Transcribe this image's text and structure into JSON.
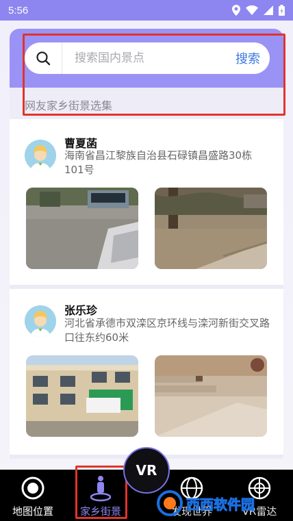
{
  "status_bar": {
    "time": "5:56"
  },
  "search": {
    "placeholder": "搜索国内景点",
    "button_label": "搜索"
  },
  "section": {
    "title": "网友家乡街景选集"
  },
  "posts": [
    {
      "name": "曹夏菡",
      "address": "海南省昌江黎族自治县石碌镇昌盛路30栋101号"
    },
    {
      "name": "张乐珍",
      "address": "河北省承德市双滦区京环线与滦河新街交叉路口往东约60米"
    }
  ],
  "bottom_nav": {
    "items": [
      {
        "label": "地图位置",
        "icon": "target-icon"
      },
      {
        "label": "家乡街景",
        "icon": "person-pin-icon"
      },
      {
        "label": "发现世界",
        "icon": "globe-icon"
      },
      {
        "label": "VR雷达",
        "icon": "radar-icon"
      }
    ],
    "vr_label": "VR"
  },
  "watermark": {
    "text": "西西软件园"
  },
  "colors": {
    "accent": "#9a92f5",
    "link": "#3a78e0",
    "highlight": "#e0342b"
  }
}
